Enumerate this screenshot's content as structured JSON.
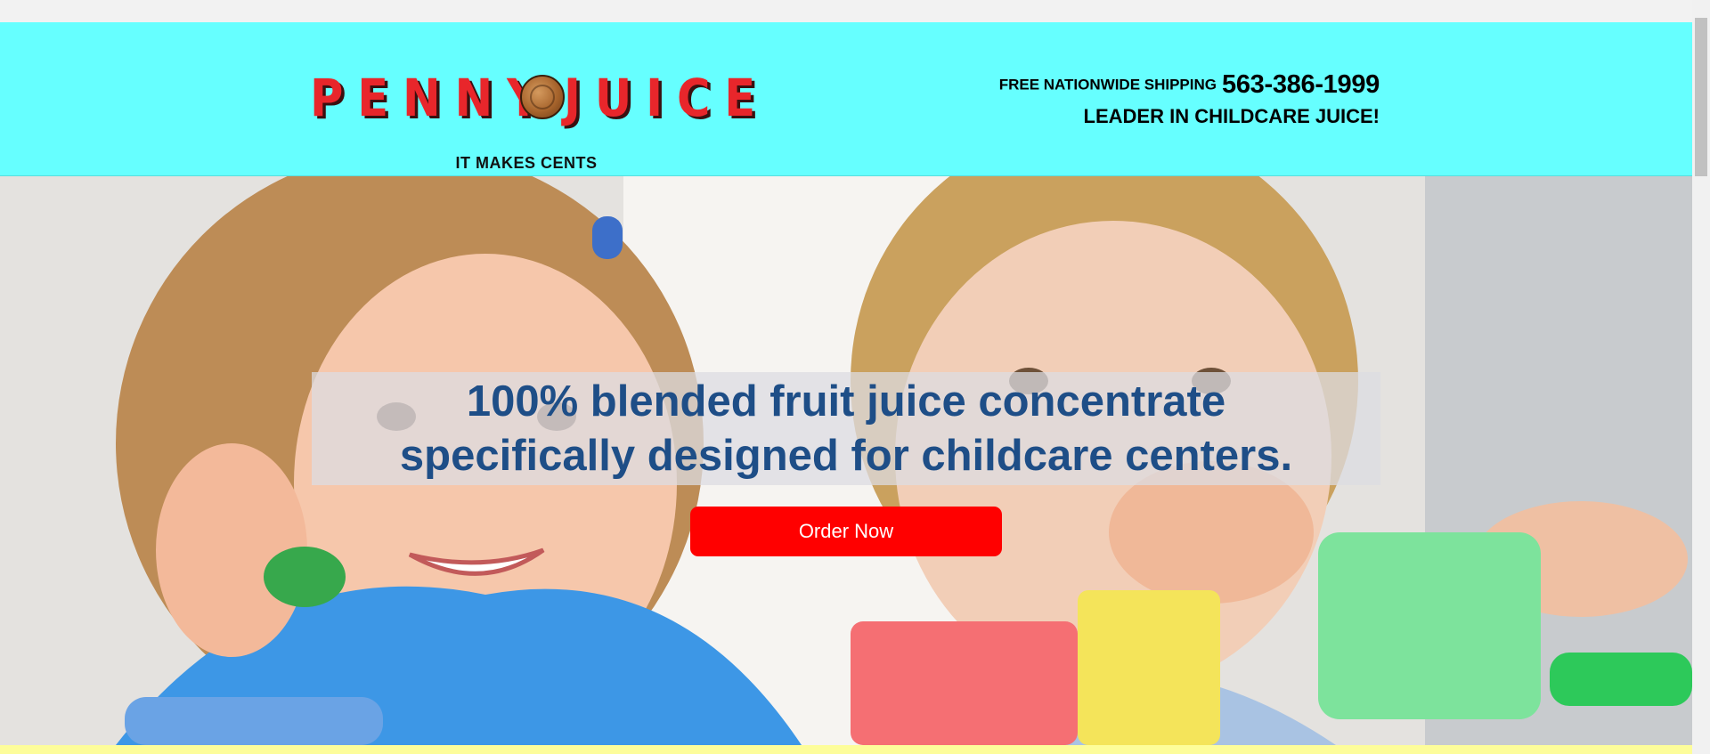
{
  "header": {
    "logo": {
      "word_left": "PENNY",
      "word_right": "JUICE"
    },
    "tagline": "IT MAKES CENTS",
    "shipping_label": "FREE NATIONWIDE SHIPPING",
    "phone": "563-386-1999",
    "slogan": "LEADER IN CHILDCARE JUICE!"
  },
  "hero": {
    "headline": "100% blended fruit juice concentrate specifically designed for childcare centers.",
    "cta_label": "Order Now"
  },
  "colors": {
    "header_bg": "#66ffff",
    "headline": "#1e4e87",
    "cta_bg": "#ff0000",
    "logo_red": "#e8262b",
    "footer_strip": "#fdfd9a"
  },
  "icons": {
    "logo_penny": "penny-coin-icon"
  }
}
